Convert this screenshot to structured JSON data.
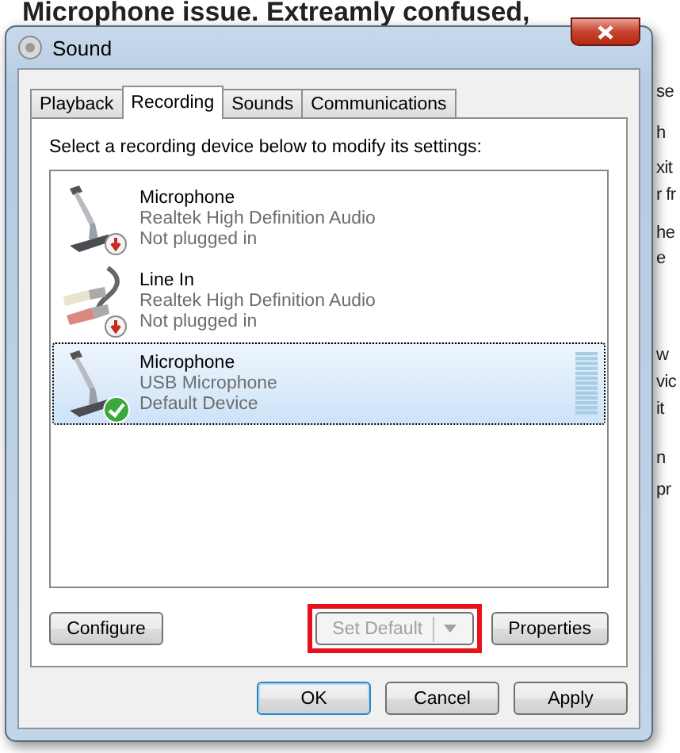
{
  "page": {
    "headline": "Microphone issue. Extreamly confused,",
    "fragments": [
      "se",
      "h",
      "xit",
      "r fr",
      "he",
      "e",
      "w",
      "vic",
      "it",
      "n",
      "pr"
    ]
  },
  "window": {
    "title": "Sound"
  },
  "tabs": [
    {
      "label": "Playback",
      "selected": false
    },
    {
      "label": "Recording",
      "selected": true
    },
    {
      "label": "Sounds",
      "selected": false
    },
    {
      "label": "Communications",
      "selected": false
    }
  ],
  "instruction": "Select a recording device below to modify its settings:",
  "devices": [
    {
      "kind": "microphone",
      "name": "Microphone",
      "driver": "Realtek High Definition Audio",
      "status": "Not plugged in",
      "default": false,
      "selected": false
    },
    {
      "kind": "line-in",
      "name": "Line In",
      "driver": "Realtek High Definition Audio",
      "status": "Not plugged in",
      "default": false,
      "selected": false
    },
    {
      "kind": "microphone",
      "name": "Microphone",
      "driver": "USB Microphone",
      "status": "Default Device",
      "default": true,
      "selected": true
    }
  ],
  "configure": {
    "label": "Configure"
  },
  "set_default": {
    "label": "Set Default",
    "disabled": true,
    "highlighted": true
  },
  "properties": {
    "label": "Properties"
  },
  "dialog_buttons": [
    {
      "label": "OK",
      "default": true
    },
    {
      "label": "Cancel",
      "default": false
    },
    {
      "label": "Apply",
      "default": false
    }
  ]
}
